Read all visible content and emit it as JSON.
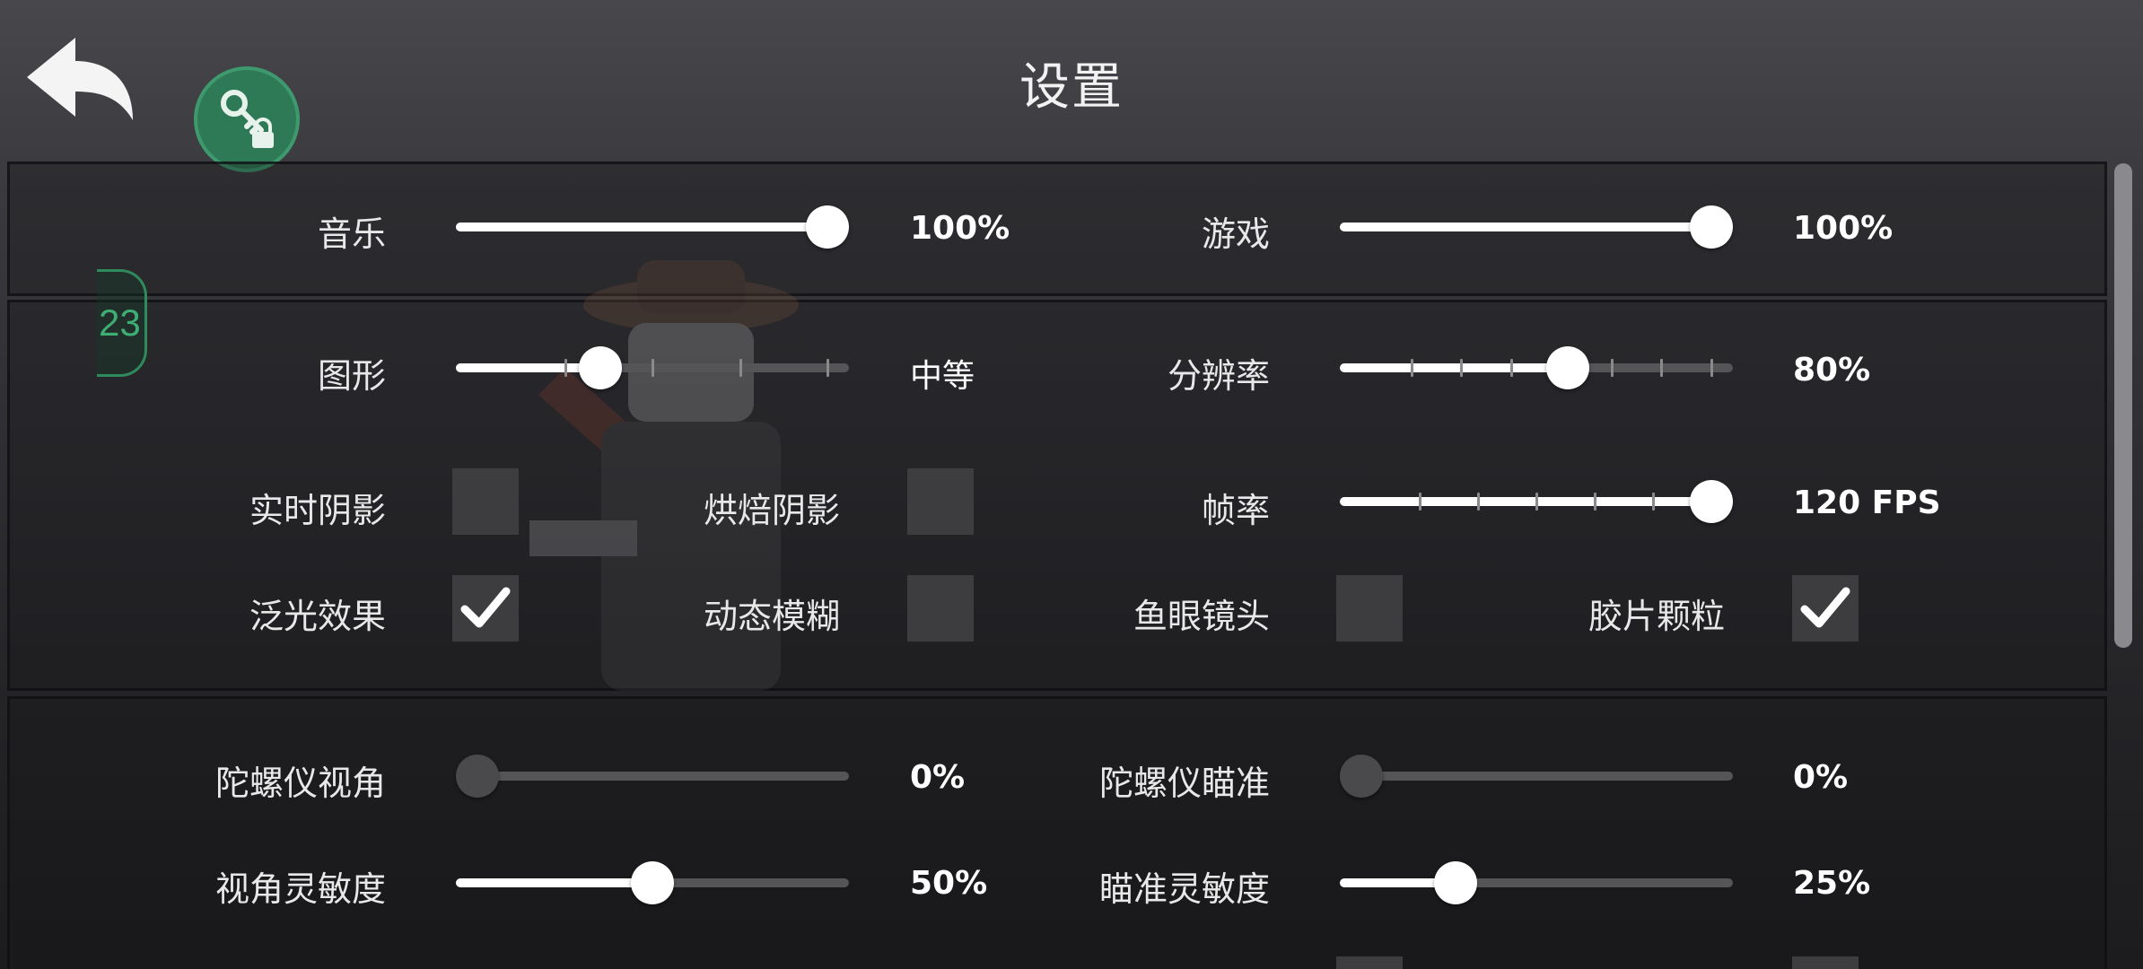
{
  "header": {
    "title": "设置",
    "back_icon": "back-arrow-icon",
    "key_icon": "key-lock-icon",
    "accent_color": "#2f7a56"
  },
  "badge": {
    "text": "23"
  },
  "audio": {
    "music": {
      "label": "音乐",
      "value": "100%",
      "level": 1.0
    },
    "game": {
      "label": "游戏",
      "value": "100%",
      "level": 1.0
    }
  },
  "graphics": {
    "quality": {
      "label": "图形",
      "value": "中等",
      "level": 0.35
    },
    "resolution": {
      "label": "分辨率",
      "value": "80%",
      "level": 0.59
    },
    "framerate": {
      "label": "帧率",
      "value": "120 FPS",
      "level": 1.0
    },
    "realtime_shadows": {
      "label": "实时阴影",
      "checked": false
    },
    "baked_shadows": {
      "label": "烘焙阴影",
      "checked": false
    },
    "bloom": {
      "label": "泛光效果",
      "checked": true
    },
    "motion_blur": {
      "label": "动态模糊",
      "checked": false
    },
    "fisheye": {
      "label": "鱼眼镜头",
      "checked": false
    },
    "film_grain": {
      "label": "胶片颗粒",
      "checked": true
    }
  },
  "controls": {
    "gyro_view": {
      "label": "陀螺仪视角",
      "value": "0%",
      "level": 0.0
    },
    "gyro_aim": {
      "label": "陀螺仪瞄准",
      "value": "0%",
      "level": 0.0
    },
    "view_sensitivity": {
      "label": "视角灵敏度",
      "value": "50%",
      "level": 0.5
    },
    "aim_sensitivity": {
      "label": "瞄准灵敏度",
      "value": "25%",
      "level": 0.27
    }
  }
}
